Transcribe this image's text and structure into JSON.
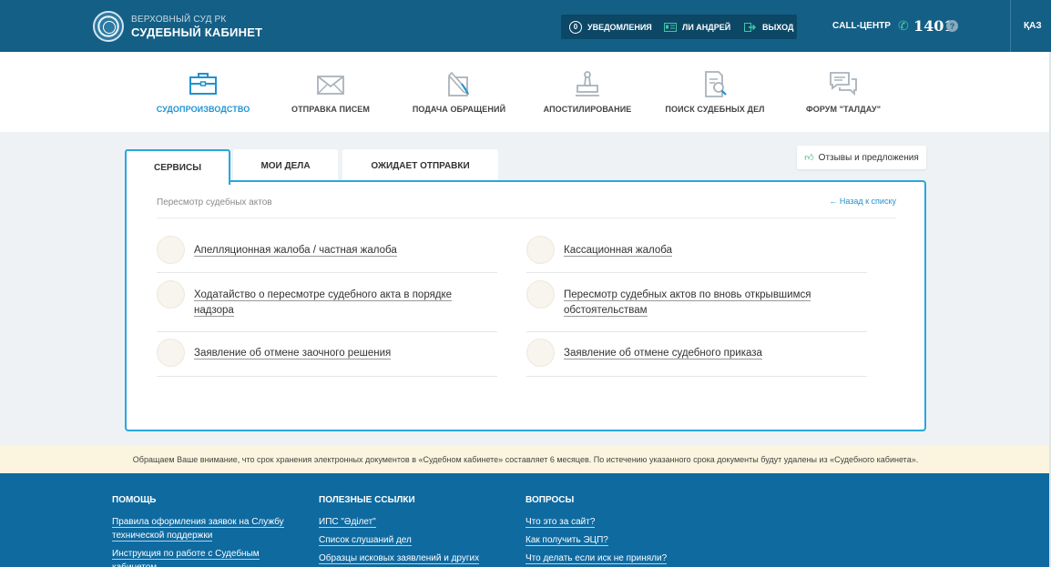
{
  "header": {
    "org": "ВЕРХОВНЫЙ СУД РК",
    "app_title": "СУДЕБНЫЙ КАБИНЕТ",
    "notifications_count": "0",
    "notifications_label": "УВЕДОМЛЕНИЯ",
    "user_name": "ЛИ АНДРЕЙ",
    "logout_label": "ВЫХОД",
    "call_center_label": "CALL-ЦЕНТР",
    "phone": "1401",
    "help": "?",
    "lang": "ҚАЗ"
  },
  "nav": [
    {
      "label": "СУДОПРОИЗВОДСТВО",
      "icon": "briefcase-icon",
      "active": true
    },
    {
      "label": "ОТПРАВКА ПИСЕМ",
      "icon": "envelope-icon",
      "active": false
    },
    {
      "label": "ПОДАЧА ОБРАЩЕНИЙ",
      "icon": "pen-document-icon",
      "active": false
    },
    {
      "label": "АПОСТИЛИРОВАНИЕ",
      "icon": "stamp-icon",
      "active": false
    },
    {
      "label": "ПОИСК СУДЕБНЫХ ДЕЛ",
      "icon": "document-search-icon",
      "active": false
    },
    {
      "label": "ФОРУМ \"ТАЛДАУ\"",
      "icon": "chat-bubbles-icon",
      "active": false
    }
  ],
  "tabs": [
    {
      "label": "СЕРВИСЫ",
      "active": true
    },
    {
      "label": "МОИ ДЕЛА",
      "active": false
    },
    {
      "label": "ОЖИДАЕТ ОТПРАВКИ",
      "active": false
    }
  ],
  "feedback_label": "Отзывы и предложения",
  "panel": {
    "breadcrumb": "Пересмотр судебных актов",
    "back_label": "← Назад к списку",
    "services": [
      "Апелляционная жалоба / частная жалоба",
      "Кассационная жалоба",
      "Ходатайство о пересмотре судебного акта в порядке надзора",
      "Пересмотр судебных актов по вновь открывшимся обстоятельствам",
      "Заявление об отмене заочного решения",
      "Заявление об отмене судебного приказа"
    ]
  },
  "notice": "Обращаем Ваше внимание, что срок хранения электронных документов в «Судебном кабинете» составляет 6 месяцев. По истечению указанного срока документы будут удалены из «Судебного кабинета».",
  "footer": {
    "help": {
      "title": "ПОМОЩЬ",
      "links": [
        "Правила оформления заявок на Службу технической поддержки",
        "Инструкция по работе с Судебным кабинетом"
      ]
    },
    "links": {
      "title": "ПОЛЕЗНЫЕ ССЫЛКИ",
      "links": [
        "ИПС \"Әділет\"",
        "Список слушаний дел",
        "Образцы исковых заявлений и других"
      ]
    },
    "faq": {
      "title": "ВОПРОСЫ",
      "links": [
        "Что это за сайт?",
        "Как получить ЭЦП?",
        "Что делать если иск не приняли?"
      ]
    }
  }
}
